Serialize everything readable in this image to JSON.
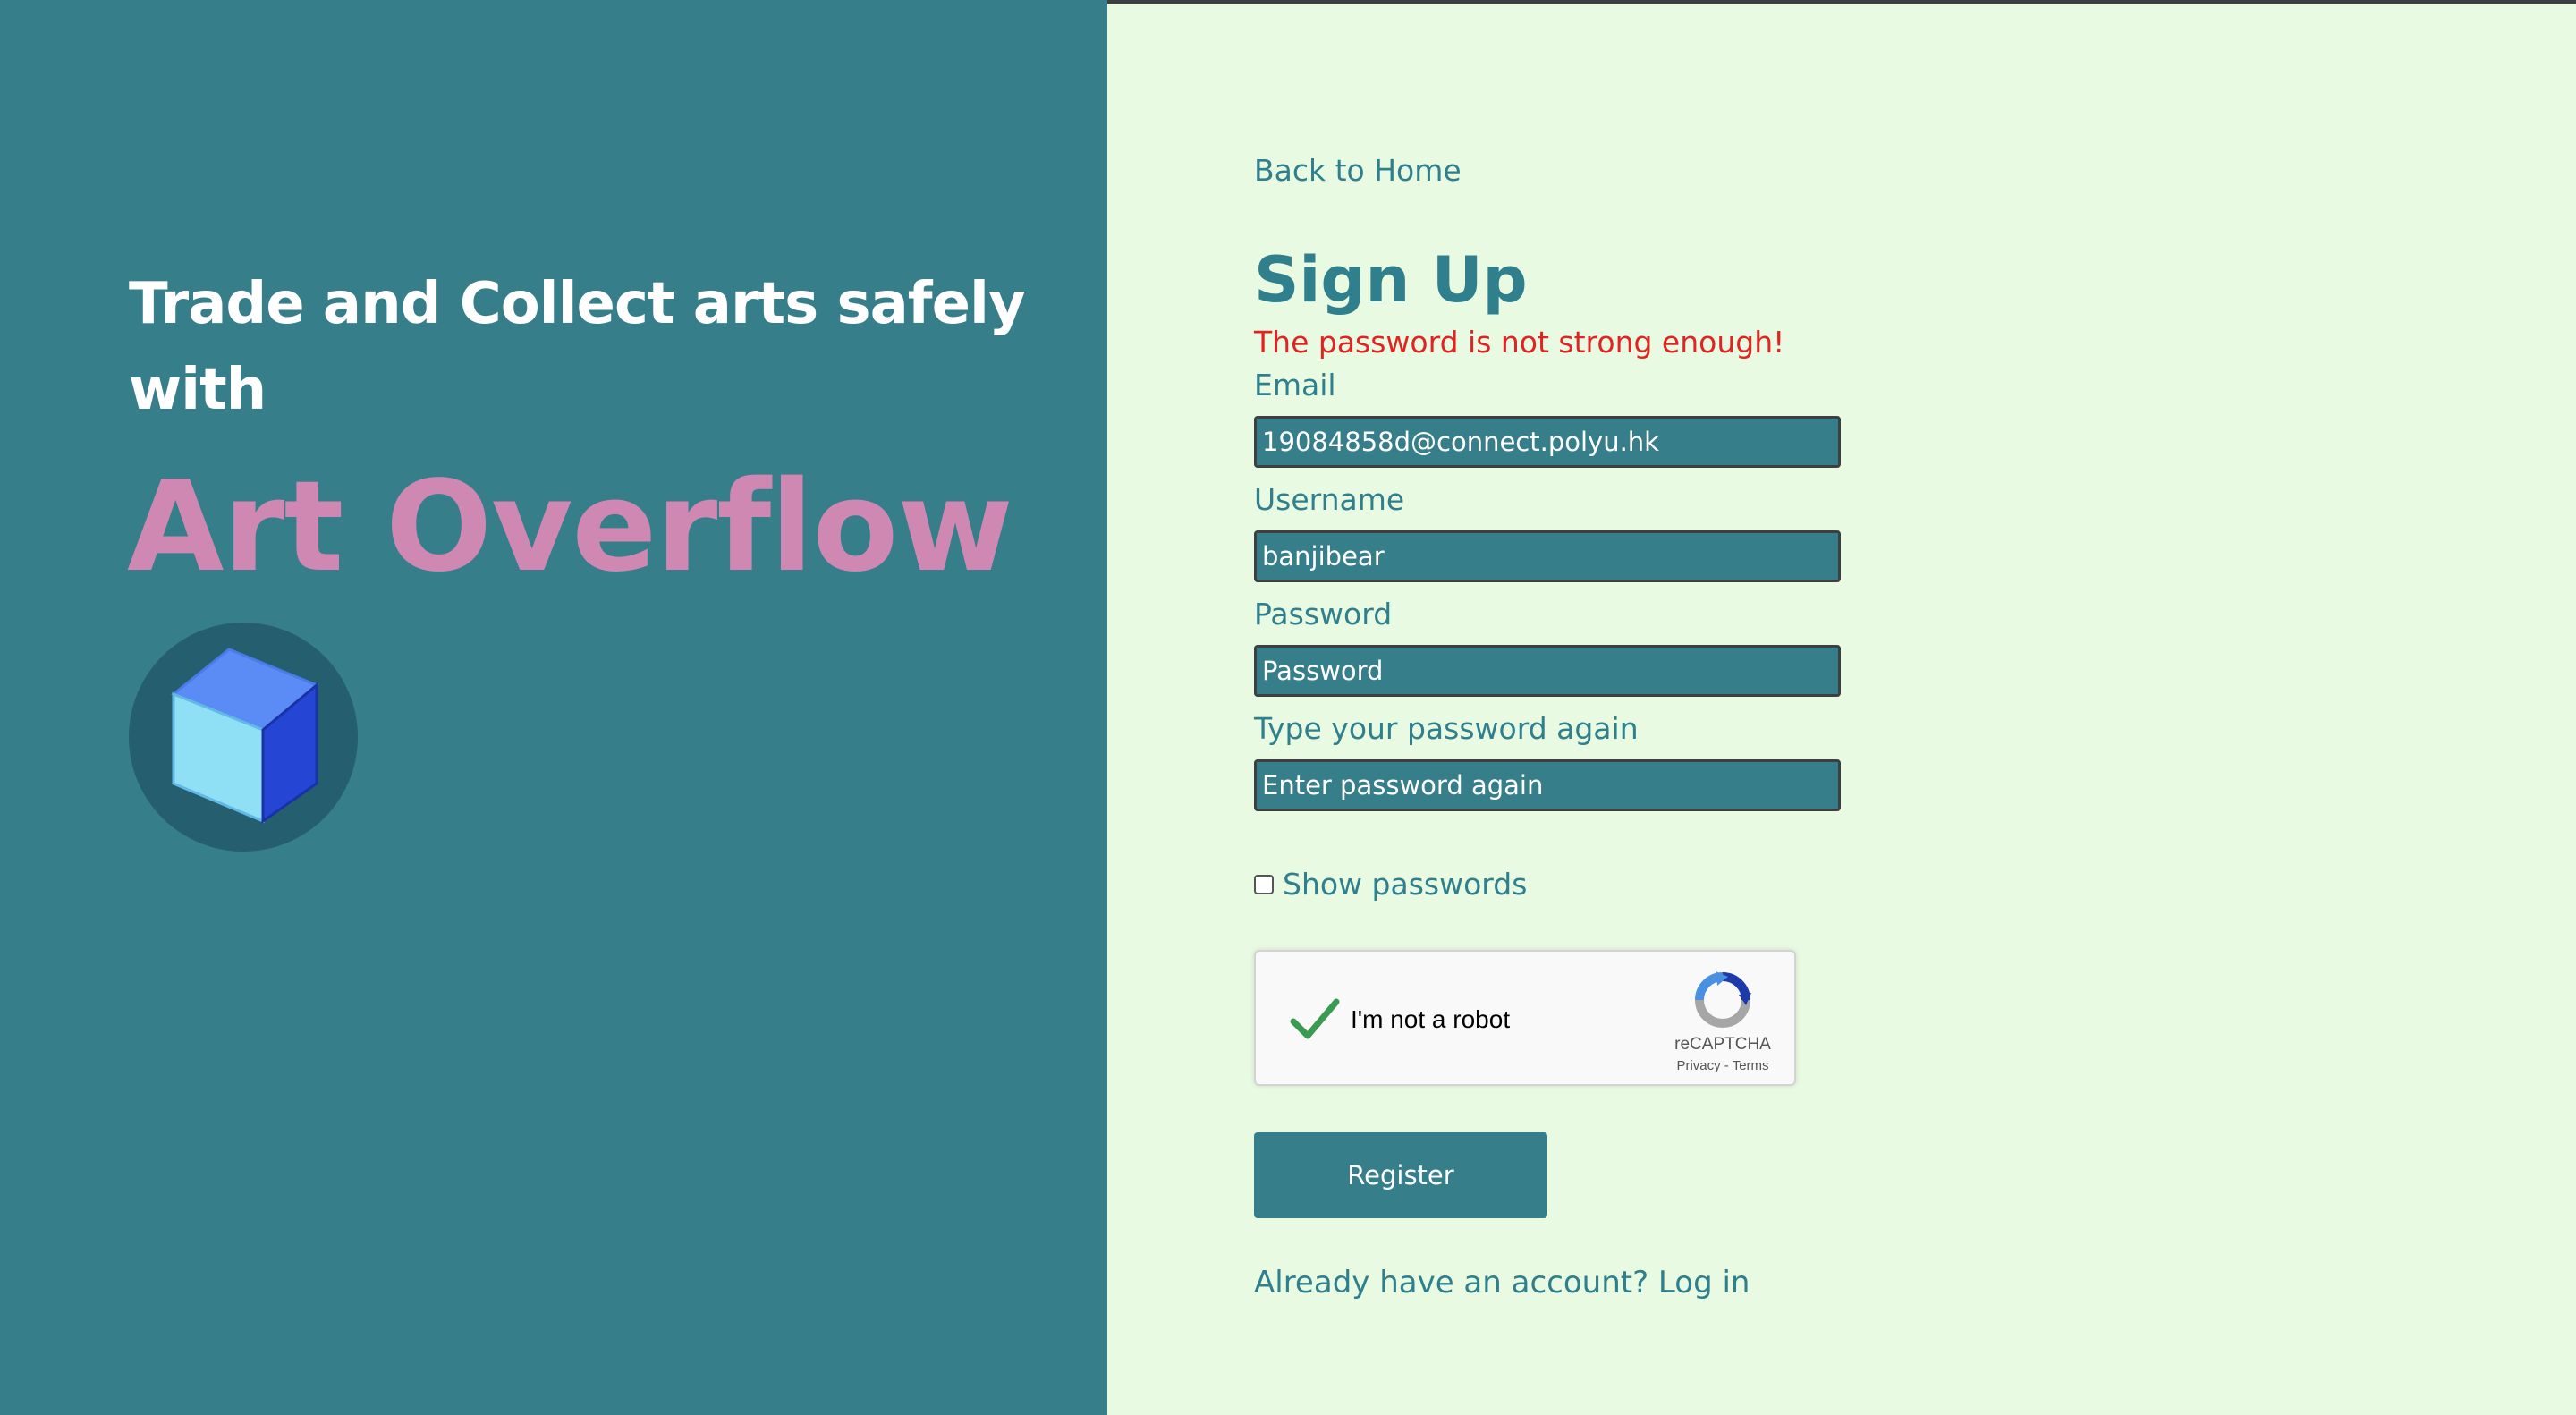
{
  "hero": {
    "tagline": "Trade and Collect arts safely with",
    "brand_name": "Art Overflow",
    "logo_icon": "blue-cube-icon",
    "colors": {
      "panel_bg": "#377e8b",
      "brand_pink": "#cf88b2",
      "logo_circle": "#245e6f"
    }
  },
  "form": {
    "back_link": "Back to Home",
    "title": "Sign Up",
    "error_message": "The password is not strong enough!",
    "email_label": "Email",
    "email_value": "19084858d@connect.polyu.hk",
    "username_label": "Username",
    "username_value": "banjibear",
    "password_label": "Password",
    "password_placeholder": "Password",
    "confirm_label": "Type your password again",
    "confirm_placeholder": "Enter password again",
    "show_passwords_label": "Show passwords",
    "show_passwords_checked": false,
    "register_label": "Register",
    "login_prompt": "Already have an account? Log in",
    "colors": {
      "page_bg": "#e8fae1",
      "accent_teal": "#2f7f8d",
      "error_red": "#e02424"
    }
  },
  "captcha": {
    "label": "I'm not a robot",
    "checked": true,
    "brand": "reCAPTCHA",
    "privacy": "Privacy",
    "separator": " - ",
    "terms": "Terms"
  }
}
